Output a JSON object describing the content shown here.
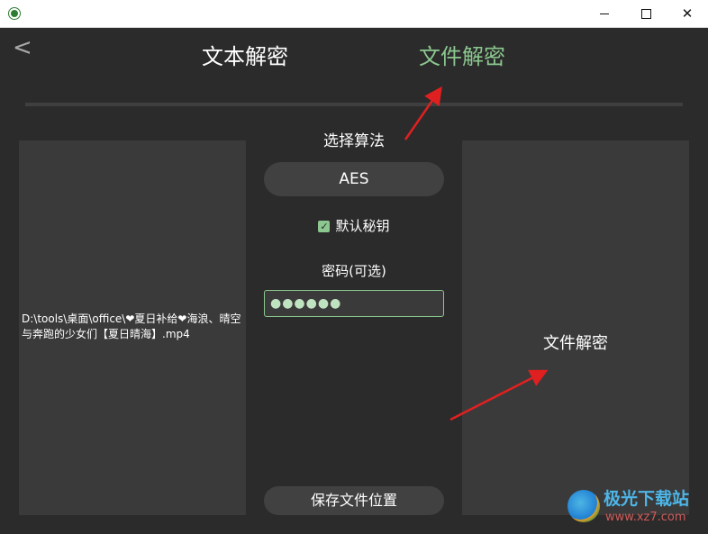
{
  "window": {
    "close_glyph": "✕"
  },
  "nav": {
    "back_glyph": "<"
  },
  "tabs": [
    {
      "label": "文本解密",
      "active": false
    },
    {
      "label": "文件解密",
      "active": true
    }
  ],
  "colors": {
    "accent": "#8bc78f",
    "background": "#2b2b2b",
    "panel": "#3a3a3a",
    "arrow": "#e02020"
  },
  "left_panel": {
    "file_path": "D:\\tools\\桌面\\office\\❤夏日补给❤海浪、晴空与奔跑的少女们【夏日晴海】.mp4"
  },
  "center": {
    "algorithm_title": "选择算法",
    "algorithm_value": "AES",
    "default_key_label": "默认秘钥",
    "default_key_checked": true,
    "checkbox_glyph": "✓",
    "password_title": "密码(可选)",
    "password_mask": "●●●●●●",
    "save_button_label": "保存文件位置"
  },
  "right_panel": {
    "decrypt_label": "文件解密"
  },
  "watermark": {
    "title": "极光下载站",
    "url": "www.xz7.com"
  }
}
